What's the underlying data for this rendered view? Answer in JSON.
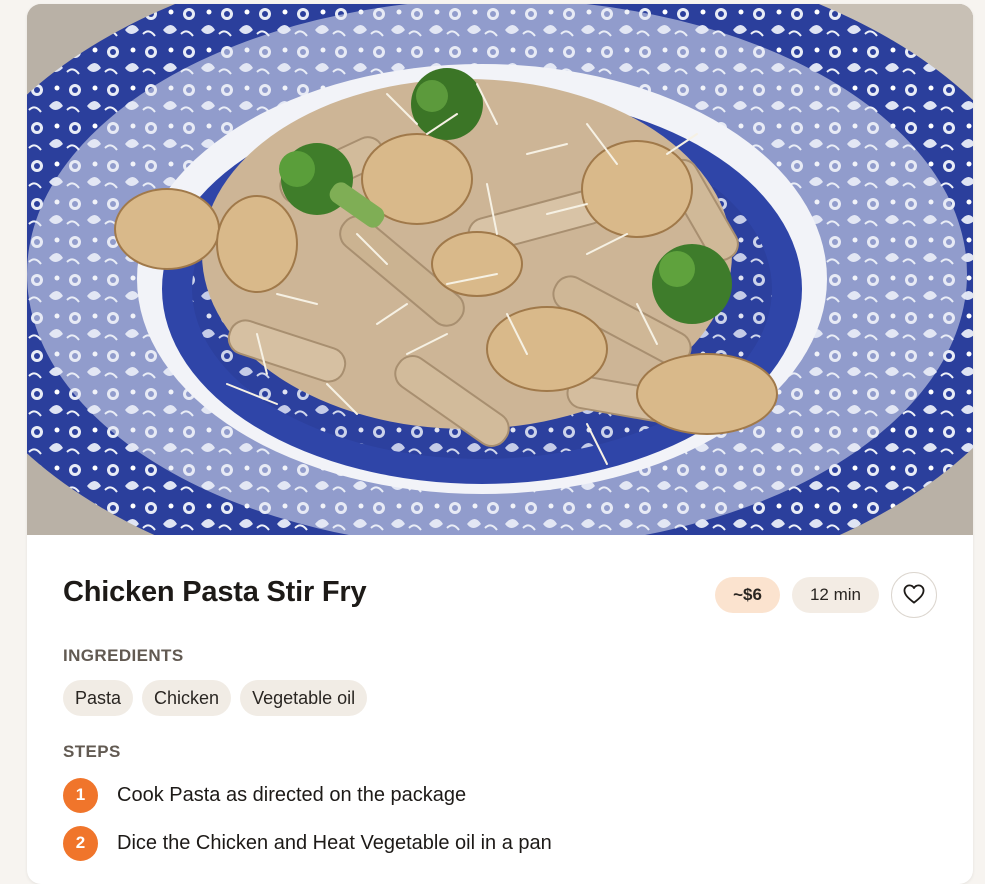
{
  "recipe": {
    "title": "Chicken Pasta Stir Fry",
    "cost": "~$6",
    "time": "12 min",
    "favorite_icon": "heart-icon",
    "photo_subject": "chicken-pasta-stir-fry-photo"
  },
  "ingredients": {
    "label": "INGREDIENTS",
    "items": [
      "Pasta",
      "Chicken",
      "Vegetable oil"
    ]
  },
  "steps": {
    "label": "STEPS",
    "items": [
      {
        "number": "1",
        "text": "Cook Pasta as directed on the package"
      },
      {
        "number": "2",
        "text": "Dice the Chicken and Heat Vegetable oil in a pan"
      }
    ]
  },
  "colors": {
    "accent": "#f0752b",
    "cost_pill": "#fbe3cf",
    "chip": "#f1ece5",
    "plate_blue": "#2b3f9c"
  }
}
